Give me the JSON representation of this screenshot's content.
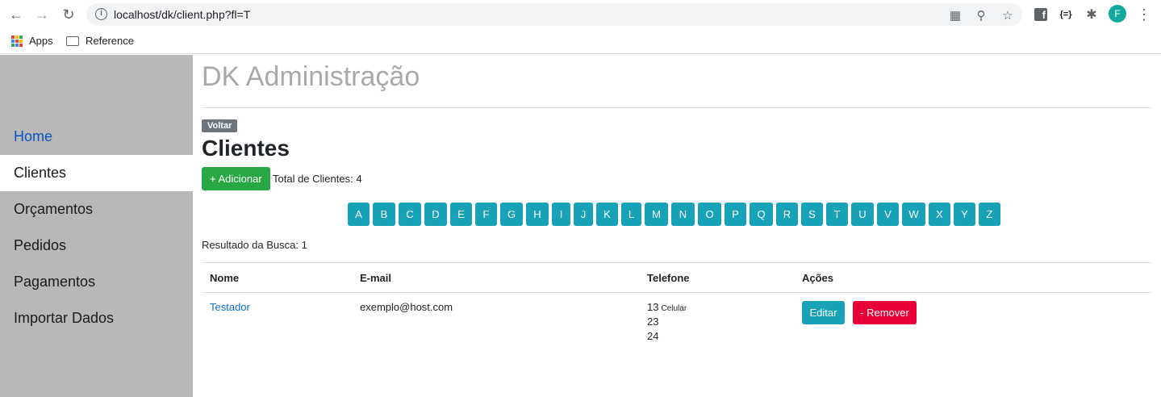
{
  "browser": {
    "url": "localhost/dk/client.php?fl=T",
    "profile_initial": "F",
    "bookmarks": [
      {
        "label": "Apps"
      },
      {
        "label": "Reference"
      }
    ]
  },
  "sidebar": {
    "items": [
      {
        "label": "Home"
      },
      {
        "label": "Clientes"
      },
      {
        "label": "Orçamentos"
      },
      {
        "label": "Pedidos"
      },
      {
        "label": "Pagamentos"
      },
      {
        "label": "Importar Dados"
      }
    ]
  },
  "main": {
    "brand": "DK Administração",
    "back_label": "Voltar",
    "page_title": "Clientes",
    "add_label": "+ Adicionar",
    "total_label": "Total de Clientes: 4",
    "letters": [
      "A",
      "B",
      "C",
      "D",
      "E",
      "F",
      "G",
      "H",
      "I",
      "J",
      "K",
      "L",
      "M",
      "N",
      "O",
      "P",
      "Q",
      "R",
      "S",
      "T",
      "U",
      "V",
      "W",
      "X",
      "Y",
      "Z"
    ],
    "result_label": "Resultado da Busca: 1"
  },
  "table": {
    "headers": {
      "name": "Nome",
      "email": "E-mail",
      "phone": "Telefone",
      "actions": "Ações"
    },
    "rows": [
      {
        "name": "Testador",
        "email": "exemplo@host.com",
        "phones": [
          {
            "number": "13",
            "type": "Celular"
          },
          {
            "number": "23",
            "type": ""
          },
          {
            "number": "24",
            "type": ""
          }
        ],
        "edit_label": "Editar",
        "remove_label": "- Remover"
      }
    ]
  },
  "colors": {
    "sidebar_bg": "#b8b8b8",
    "add_button": "#28a745",
    "letter_button": "#17a2b8",
    "remove_button": "#ea0038"
  }
}
